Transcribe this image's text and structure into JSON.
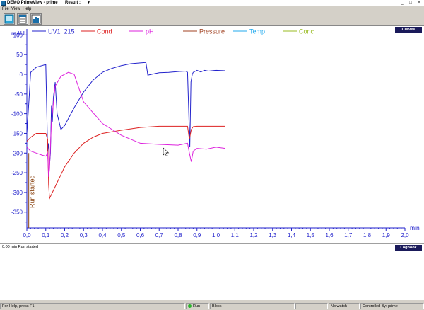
{
  "window": {
    "title": "DEMO PrimeView - prime",
    "result_label": "Result :",
    "result_arrow": "▼",
    "minimize": "_",
    "maximize": "□",
    "close": "×"
  },
  "menu": [
    "File",
    "View",
    "Help"
  ],
  "toolbar": {
    "icons": [
      "chart-view-icon",
      "run-log-icon",
      "evaluation-icon"
    ]
  },
  "panes": {
    "curves_label": "Curves",
    "logbook_label": "Logbook"
  },
  "log": {
    "entries": [
      "0.00 min Run started"
    ]
  },
  "status": {
    "help": "For Help, press F1",
    "run": "Run",
    "block": "Block",
    "watch": "No watch",
    "controlled": "Controlled By: prime"
  },
  "colors": {
    "uv": "#2222cc",
    "cond": "#dd2222",
    "ph": "#dd22dd",
    "pressure": "#a04020",
    "temp": "#22aaee",
    "conc": "#99bb22",
    "axis": "#2222cc",
    "annotation": "#8b4513"
  },
  "chart_data": {
    "type": "line",
    "ylabel": "mAU",
    "xlabel": "min",
    "xlim": [
      0.0,
      2.0
    ],
    "ylim": [
      -390,
      115
    ],
    "x_ticks": [
      "0,0",
      "0,1",
      "0,2",
      "0,3",
      "0,4",
      "0,5",
      "0,6",
      "0,7",
      "0,8",
      "0,9",
      "1,0",
      "1,1",
      "1,2",
      "1,3",
      "1,4",
      "1,5",
      "1,6",
      "1,7",
      "1,8",
      "1,9",
      "2,0"
    ],
    "y_ticks": [
      "100",
      "50",
      "0",
      "-50",
      "-100",
      "-150",
      "-200",
      "-250",
      "-300",
      "-350"
    ],
    "legend": [
      "UV1_215",
      "Cond",
      "pH",
      "Pressure",
      "Temp",
      "Conc"
    ],
    "annotation": {
      "x": 0.01,
      "text": "Run started"
    },
    "series": [
      {
        "name": "UV1_215",
        "color_key": "uv",
        "x": [
          0.0,
          0.01,
          0.02,
          0.05,
          0.08,
          0.1,
          0.11,
          0.115,
          0.12,
          0.125,
          0.13,
          0.135,
          0.14,
          0.15,
          0.16,
          0.18,
          0.2,
          0.25,
          0.3,
          0.35,
          0.4,
          0.45,
          0.5,
          0.55,
          0.6,
          0.63,
          0.64,
          0.7,
          0.75,
          0.8,
          0.84,
          0.85,
          0.86,
          0.862,
          0.868,
          0.875,
          0.88,
          0.9,
          0.92,
          0.94,
          0.96,
          1.0,
          1.05
        ],
        "y": [
          -150,
          -75,
          5,
          18,
          22,
          25,
          -195,
          -175,
          -230,
          -200,
          -80,
          -120,
          -60,
          -20,
          -100,
          -140,
          -130,
          -85,
          -45,
          -15,
          5,
          15,
          22,
          27,
          29,
          30,
          -2,
          4,
          5,
          7,
          8,
          5,
          -150,
          -185,
          -20,
          0,
          5,
          10,
          6,
          10,
          8,
          10,
          9
        ]
      },
      {
        "name": "Cond",
        "color_key": "cond",
        "x": [
          0.0,
          0.02,
          0.05,
          0.08,
          0.1,
          0.11,
          0.115,
          0.12,
          0.13,
          0.15,
          0.2,
          0.25,
          0.3,
          0.35,
          0.4,
          0.5,
          0.6,
          0.7,
          0.8,
          0.85,
          0.86,
          0.87,
          0.88,
          0.9,
          1.0,
          1.05
        ],
        "y": [
          -170,
          -160,
          -150,
          -150,
          -150,
          -165,
          -280,
          -315,
          -305,
          -285,
          -235,
          -200,
          -175,
          -160,
          -150,
          -142,
          -135,
          -132,
          -132,
          -132,
          -165,
          -140,
          -133,
          -132,
          -132,
          -132
        ]
      },
      {
        "name": "pH",
        "color_key": "ph",
        "x": [
          0.0,
          0.02,
          0.05,
          0.08,
          0.1,
          0.11,
          0.115,
          0.12,
          0.13,
          0.15,
          0.18,
          0.22,
          0.25,
          0.3,
          0.4,
          0.5,
          0.6,
          0.7,
          0.8,
          0.85,
          0.86,
          0.87,
          0.88,
          0.9,
          0.95,
          1.0,
          1.05
        ],
        "y": [
          -185,
          -195,
          -200,
          -205,
          -208,
          -200,
          -260,
          -240,
          -120,
          -30,
          -5,
          5,
          0,
          -70,
          -125,
          -155,
          -175,
          -178,
          -180,
          -175,
          -200,
          -222,
          -195,
          -188,
          -190,
          -185,
          -188
        ]
      }
    ]
  }
}
